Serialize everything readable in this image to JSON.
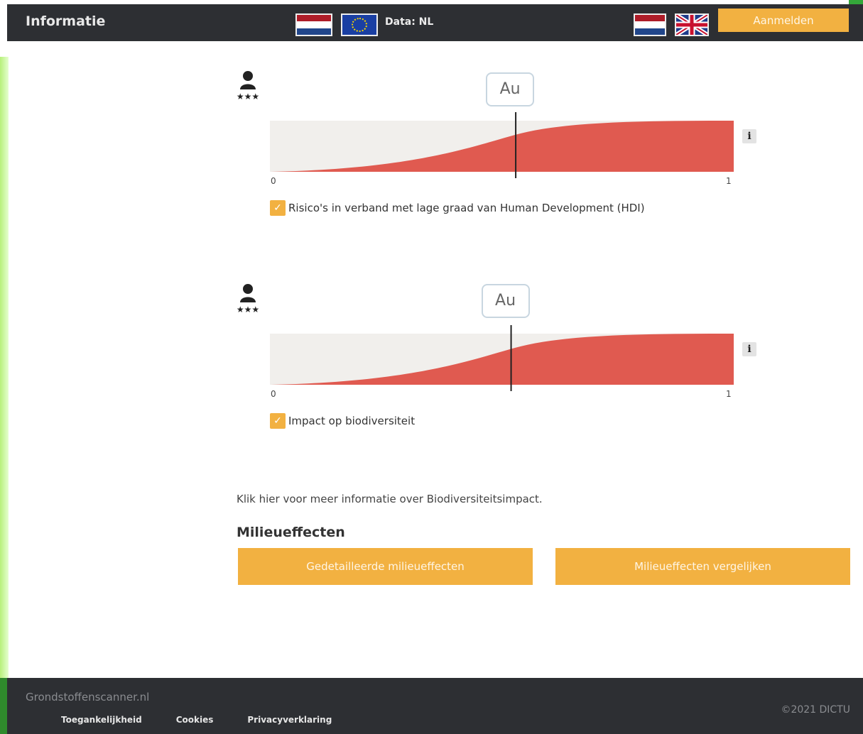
{
  "header": {
    "title": "Informatie",
    "data_label": "Data: NL",
    "login_label": "Aanmelden",
    "flags": [
      "flag-nl-icon",
      "flag-eu-icon",
      "flag-nl-icon",
      "flag-uk-icon"
    ]
  },
  "charts": [
    {
      "tick_min": "0",
      "tick_max": "1",
      "marker_label": "Au",
      "marker_value": 0.53,
      "checkbox_checked": true,
      "label": "Risico's in verband met lage graad van Human Development (HDI)"
    },
    {
      "tick_min": "0",
      "tick_max": "1",
      "marker_label": "Au",
      "marker_value": 0.52,
      "checkbox_checked": true,
      "label": "Impact op biodiversiteit"
    }
  ],
  "main": {
    "more_info": "Klik hier voor meer informatie over Biodiversiteitsimpact.",
    "section_title": "Milieueffecten",
    "btn_detail": "Gedetailleerde milieueffecten",
    "btn_compare": "Milieueffecten vergelijken"
  },
  "footer": {
    "site": "Grondstoffenscanner.nl",
    "links": [
      "Toegankelijkheid",
      "Cookies",
      "Privacyverklaring"
    ],
    "copyright": "©2021 DICTU"
  },
  "colors": {
    "header_bg": "#2d2f33",
    "accent": "#f2b141",
    "risk_fill": "#e05a50",
    "track_bg": "#f1efec"
  }
}
